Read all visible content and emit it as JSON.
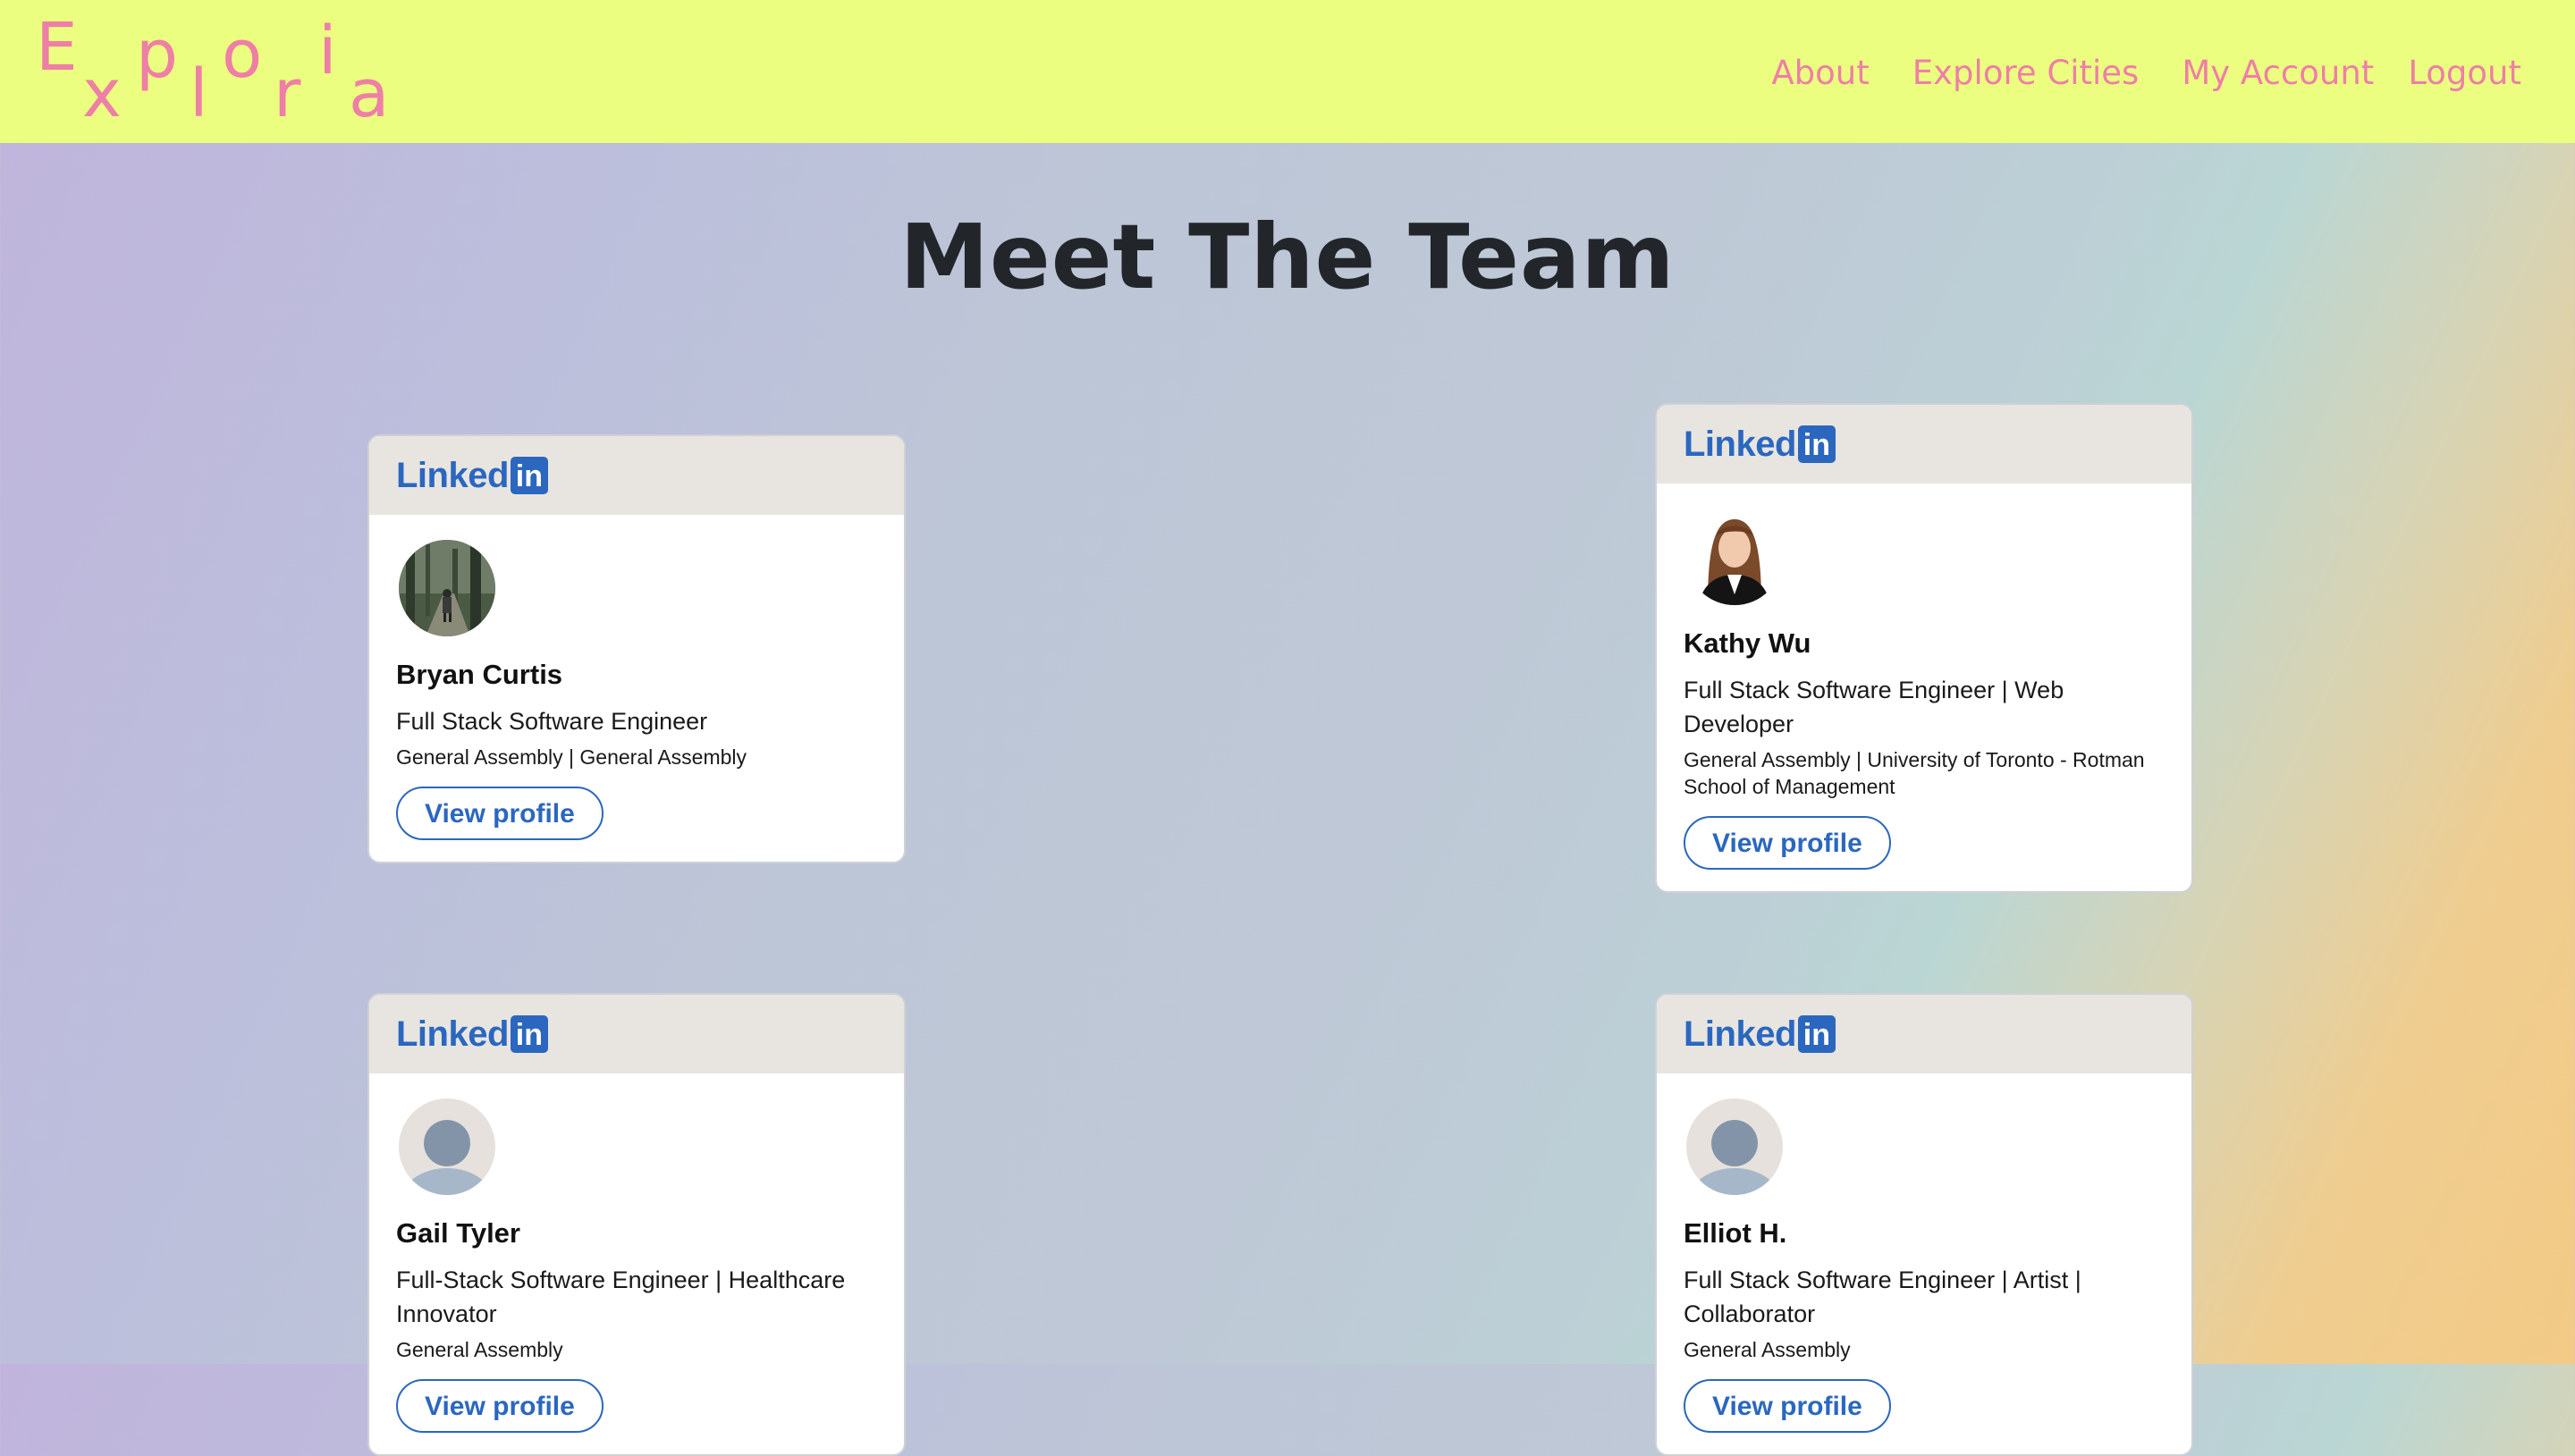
{
  "header": {
    "logo_letters": [
      "E",
      "x",
      "p",
      "l",
      "o",
      "r",
      "i",
      "a"
    ],
    "nav": [
      "About",
      "Explore Cities",
      "My Account",
      "Logout"
    ]
  },
  "main": {
    "title": "Meet The Team"
  },
  "cards": [
    {
      "brand": "Linked",
      "brand_box": "in",
      "name": "Bryan Curtis",
      "headline": "Full Stack Software Engineer",
      "school": "General Assembly | General Assembly",
      "button": "View profile"
    },
    {
      "brand": "Linked",
      "brand_box": "in",
      "name": "Kathy Wu",
      "headline": "Full Stack Software Engineer | Web Developer",
      "school": "General Assembly | University of Toronto - Rotman School of Management",
      "button": "View profile"
    },
    {
      "brand": "Linked",
      "brand_box": "in",
      "name": "Gail Tyler",
      "headline": "Full-Stack Software Engineer | Healthcare Innovator",
      "school": "General Assembly",
      "button": "View profile"
    },
    {
      "brand": "Linked",
      "brand_box": "in",
      "name": "Elliot H.",
      "headline": "Full Stack Software Engineer | Artist | Collaborator",
      "school": "General Assembly",
      "button": "View profile"
    }
  ],
  "colors": {
    "header_bg": "#ecfe80",
    "logo_pink": "#ee7fa6",
    "linkedin_blue": "#2b67bf",
    "card_header_bg": "#e8e5e0"
  }
}
